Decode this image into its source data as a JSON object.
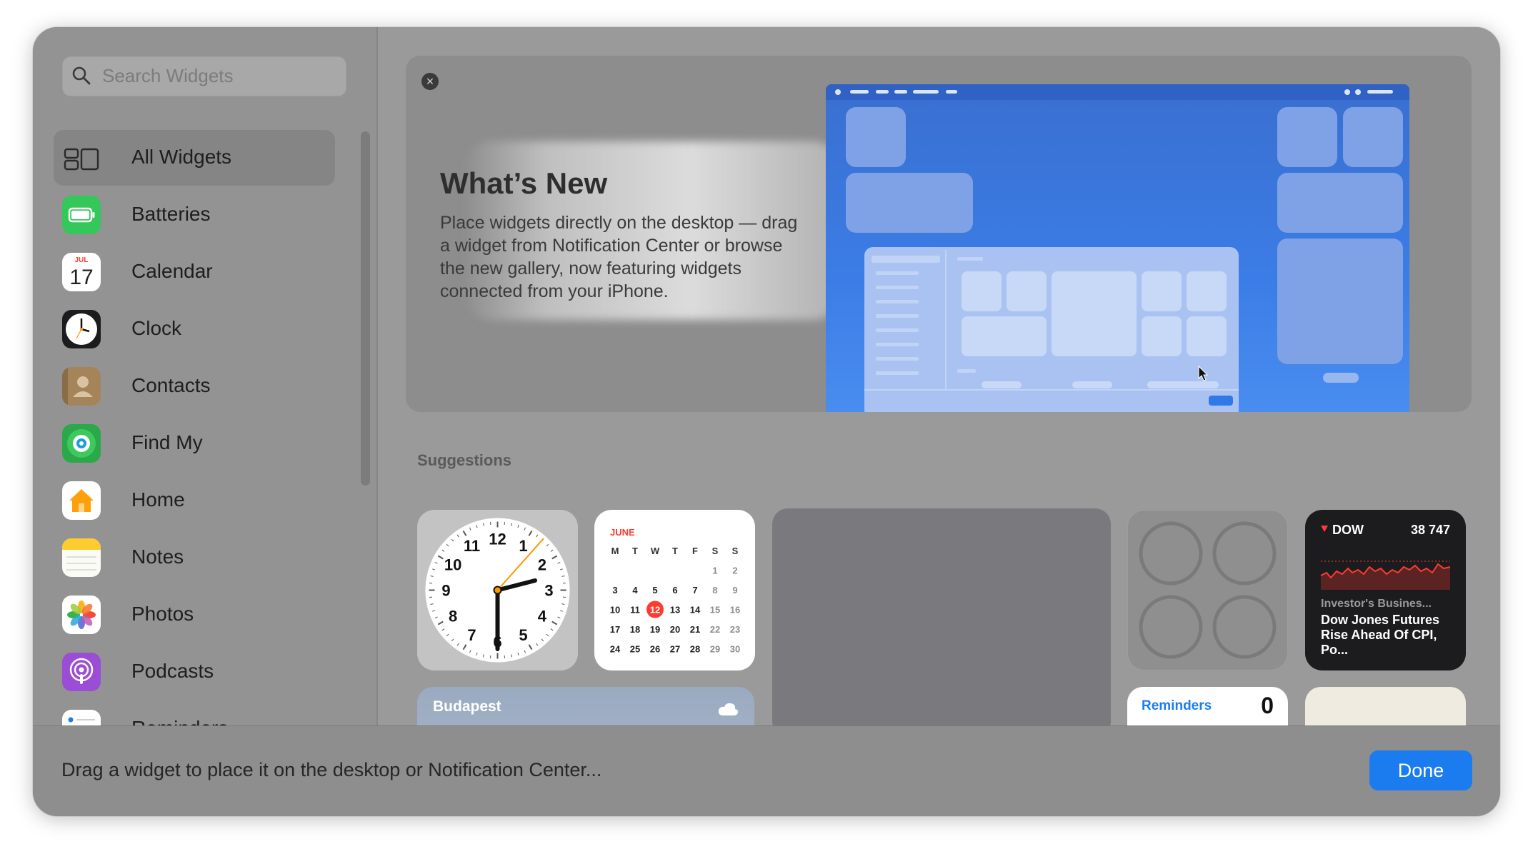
{
  "search": {
    "placeholder": "Search Widgets"
  },
  "sidebar": {
    "items": [
      {
        "label": "All Widgets",
        "icon": "all-widgets-icon",
        "selected": true
      },
      {
        "label": "Batteries",
        "icon": "batteries-app-icon"
      },
      {
        "label": "Calendar",
        "icon": "calendar-app-icon"
      },
      {
        "label": "Clock",
        "icon": "clock-app-icon"
      },
      {
        "label": "Contacts",
        "icon": "contacts-app-icon"
      },
      {
        "label": "Find My",
        "icon": "find-my-app-icon"
      },
      {
        "label": "Home",
        "icon": "home-app-icon"
      },
      {
        "label": "Notes",
        "icon": "notes-app-icon"
      },
      {
        "label": "Photos",
        "icon": "photos-app-icon"
      },
      {
        "label": "Podcasts",
        "icon": "podcasts-app-icon"
      },
      {
        "label": "Reminders",
        "icon": "reminders-app-icon"
      }
    ],
    "calendar_icon_month": "JUL",
    "calendar_icon_day": "17"
  },
  "banner": {
    "title": "What’s New",
    "body": "Place widgets directly on the desktop — drag a widget from Notification Center or browse the new gallery, now featuring widgets connected from your iPhone."
  },
  "suggestions": {
    "title": "Suggestions",
    "clock_numbers": [
      "12",
      "1",
      "2",
      "3",
      "4",
      "5",
      "6",
      "7",
      "8",
      "9",
      "10",
      "11"
    ],
    "calendar": {
      "month": "JUNE",
      "weekdays": [
        "M",
        "T",
        "W",
        "T",
        "F",
        "S",
        "S"
      ],
      "weeks": [
        [
          "",
          "",
          "",
          "",
          "",
          "1",
          "2"
        ],
        [
          "3",
          "4",
          "5",
          "6",
          "7",
          "8",
          "9"
        ],
        [
          "10",
          "11",
          "12",
          "13",
          "14",
          "15",
          "16"
        ],
        [
          "17",
          "18",
          "19",
          "20",
          "21",
          "22",
          "23"
        ],
        [
          "24",
          "25",
          "26",
          "27",
          "28",
          "29",
          "30"
        ]
      ],
      "today": "12"
    },
    "stocks": {
      "symbol": "DOW",
      "value": "38 747",
      "source": "Investor's Busines...",
      "headline": "Dow Jones Futures Rise Ahead Of CPI, Po..."
    },
    "weather": {
      "city": "Budapest"
    },
    "reminders": {
      "title": "Reminders",
      "count": "0"
    }
  },
  "footer": {
    "hint": "Drag a widget to place it on the desktop or Notification Center...",
    "done_label": "Done"
  },
  "colors": {
    "accent": "#1b7cf0",
    "calendar_today": "#ff3b30",
    "stocks_down": "#ff3b30"
  }
}
